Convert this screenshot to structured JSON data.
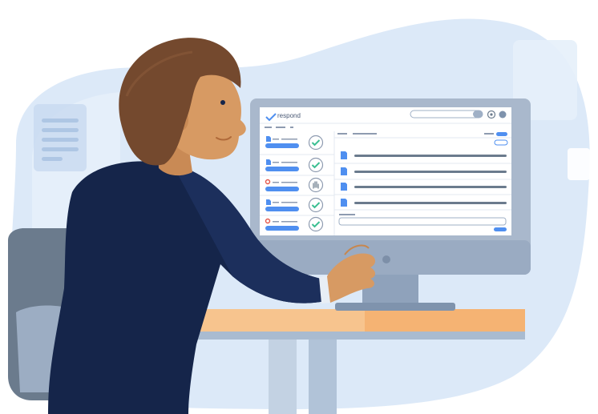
{
  "app": {
    "logo_text": "respond"
  },
  "colors": {
    "background_blob": "#dce9f8",
    "background_blob_light": "#e8f1fb",
    "monitor_frame": "#a9b8cc",
    "monitor_stand": "#8fa2bb",
    "screen_bg": "#ffffff",
    "accent_blue": "#4f8ff0",
    "check_green": "#3bbf92",
    "desk_top": "#f7c48e",
    "desk_edge": "#f0b070",
    "chair": "#6b7b8d",
    "chair_dark": "#4c5b6c",
    "jacket": "#15254a",
    "hair": "#74492e",
    "skin": "#d79a63"
  },
  "sidebar": {
    "items": [
      {
        "icon": "document-icon",
        "status_icon": "check-circle-icon"
      },
      {
        "icon": "document-icon",
        "status_icon": "check-circle-icon"
      },
      {
        "icon": "google-icon",
        "status_icon": "hand-icon"
      },
      {
        "icon": "document-icon",
        "status_icon": "check-circle-icon"
      },
      {
        "icon": "google-icon",
        "status_icon": "check-circle-icon"
      }
    ]
  },
  "main": {
    "document_count": 4
  }
}
